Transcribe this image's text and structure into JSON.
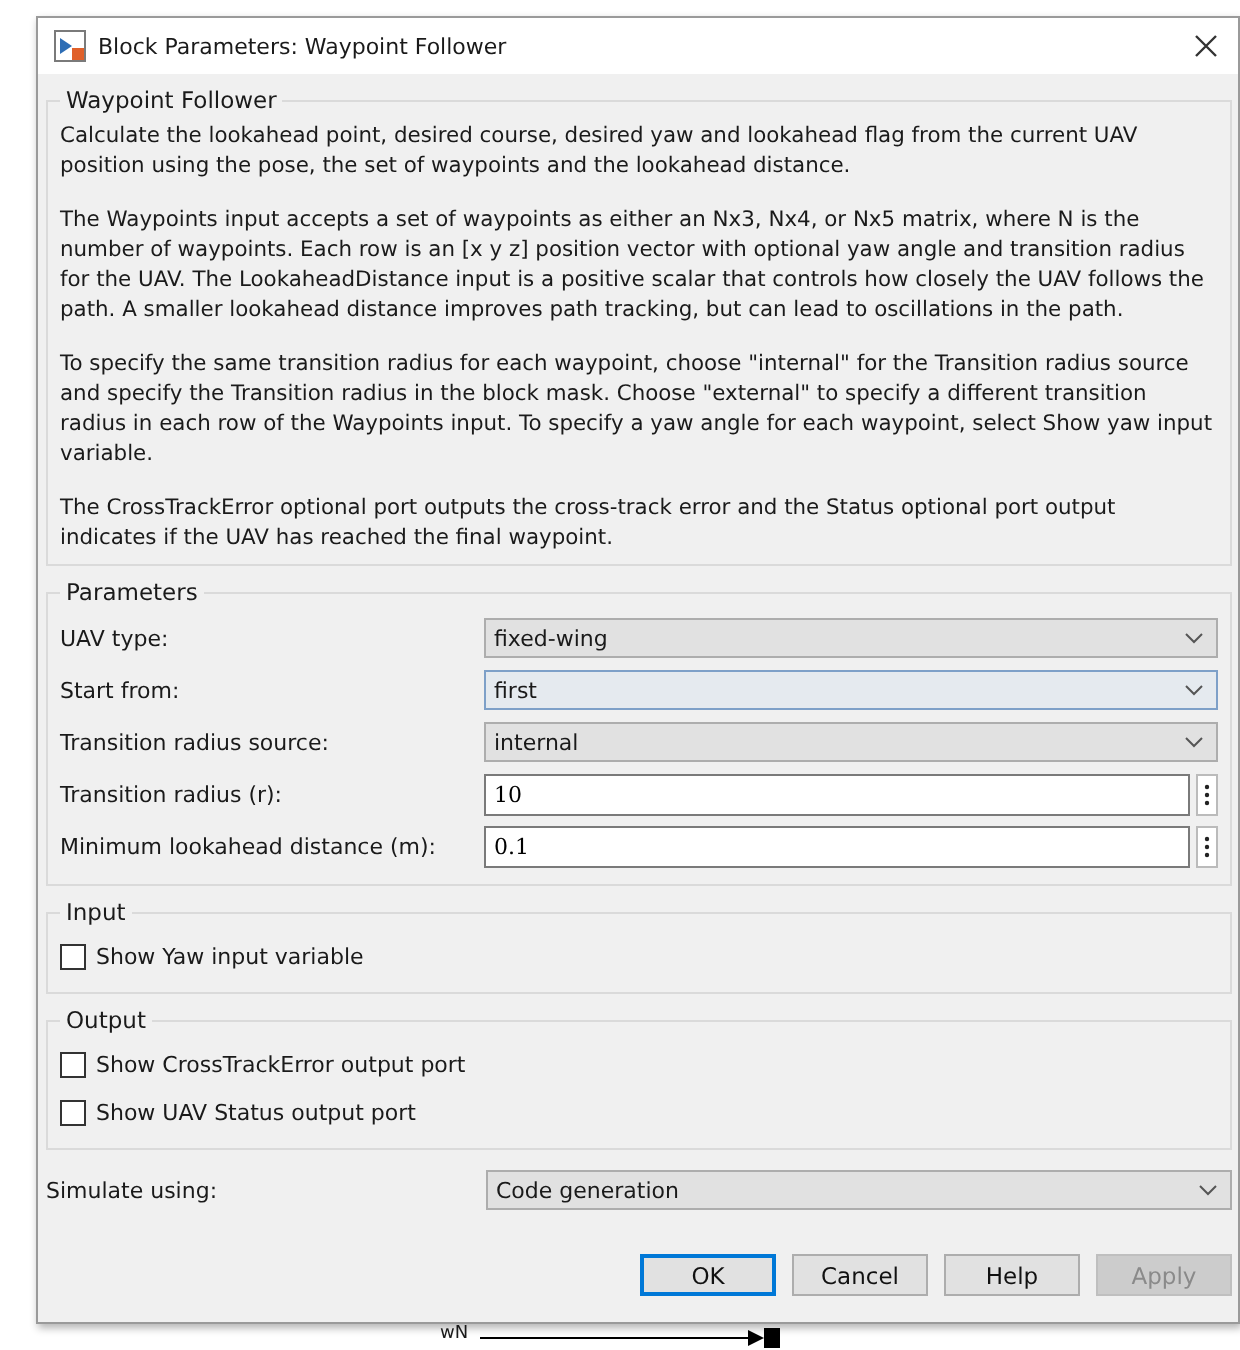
{
  "window": {
    "title": "Block Parameters: Waypoint Follower"
  },
  "description": {
    "title": "Waypoint Follower",
    "paragraphs": [
      "Calculate the lookahead point, desired course, desired yaw and lookahead flag from the current UAV position using the pose, the set of waypoints and the lookahead distance.",
      "The Waypoints input accepts a set of waypoints as either an Nx3, Nx4, or Nx5 matrix, where N is the number of waypoints. Each row is an [x y z] position vector with optional yaw angle and transition radius for the UAV. The LookaheadDistance input is a positive scalar that controls how closely the UAV follows the path. A smaller lookahead distance improves path tracking, but can lead to oscillations in the path.",
      "To specify the same transition radius for each waypoint, choose \"internal\" for the Transition radius source and specify the Transition radius in the block mask. Choose \"external\" to specify a different transition radius in each row of the Waypoints input. To specify a yaw angle for each waypoint, select Show yaw input variable.",
      "The CrossTrackError optional port outputs the cross-track error and the Status optional port output indicates if the UAV has reached the final waypoint."
    ]
  },
  "parameters": {
    "title": "Parameters",
    "rows": [
      {
        "label": "UAV type:",
        "kind": "dropdown",
        "value": "fixed-wing",
        "focused": false
      },
      {
        "label": "Start from:",
        "kind": "dropdown",
        "value": "first",
        "focused": true
      },
      {
        "label": "Transition radius source:",
        "kind": "dropdown",
        "value": "internal",
        "focused": false
      },
      {
        "label": "Transition radius (r):",
        "kind": "edit",
        "value": "10",
        "focused": false
      },
      {
        "label": "Minimum lookahead distance (m):",
        "kind": "edit",
        "value": "0.1",
        "focused": false
      }
    ]
  },
  "input": {
    "title": "Input",
    "checkboxes": [
      {
        "label": "Show Yaw input variable",
        "checked": false
      }
    ]
  },
  "output": {
    "title": "Output",
    "checkboxes": [
      {
        "label": "Show CrossTrackError output port",
        "checked": false
      },
      {
        "label": "Show UAV Status output port",
        "checked": false
      }
    ]
  },
  "simulate": {
    "label": "Simulate using:",
    "value": "Code generation"
  },
  "buttons": [
    {
      "label": "OK",
      "default": true,
      "disabled": false
    },
    {
      "label": "Cancel",
      "default": false,
      "disabled": false
    },
    {
      "label": "Help",
      "default": false,
      "disabled": false
    },
    {
      "label": "Apply",
      "default": false,
      "disabled": true
    }
  ],
  "background": {
    "port_label": "wN"
  }
}
